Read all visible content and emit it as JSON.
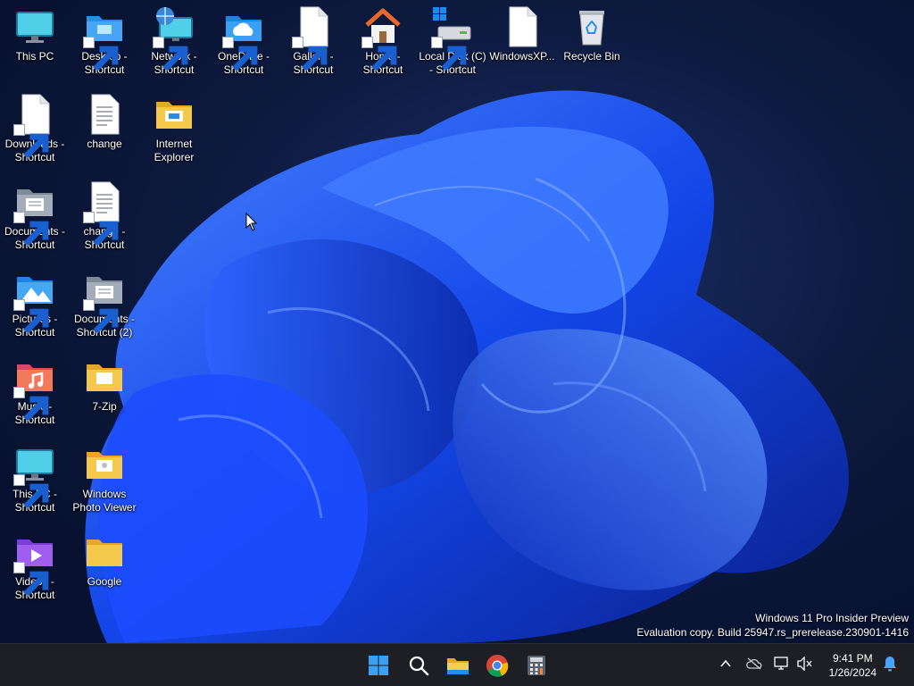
{
  "desktop": {
    "icons": [
      {
        "label": "This PC",
        "icon": "monitor-icon"
      },
      {
        "label": "Desktop -\nShortcut",
        "icon": "folder-desktop-icon"
      },
      {
        "label": "Network -\nShortcut",
        "icon": "network-icon"
      },
      {
        "label": "OneDrive -\nShortcut",
        "icon": "onedrive-folder-icon"
      },
      {
        "label": "Gallery -\nShortcut",
        "icon": "document-icon"
      },
      {
        "label": "Home -\nShortcut",
        "icon": "home-icon"
      },
      {
        "label": "Local Disk (C)\n- Shortcut",
        "icon": "drive-icon"
      },
      {
        "label": "WindowsXP...",
        "icon": "document-icon"
      },
      {
        "label": "Recycle Bin",
        "icon": "recycle-bin-icon"
      },
      {
        "label": "Downloads -\nShortcut",
        "icon": "document-icon"
      },
      {
        "label": "change",
        "icon": "text-file-icon"
      },
      {
        "label": "Internet\nExplorer",
        "icon": "folder-icon"
      },
      {
        "label": "Documents -\nShortcut",
        "icon": "documents-folder-icon"
      },
      {
        "label": "change -\nShortcut",
        "icon": "text-file-icon"
      },
      {
        "label": "Pictures -\nShortcut",
        "icon": "pictures-folder-icon"
      },
      {
        "label": "Documents -\nShortcut (2)",
        "icon": "documents-folder-icon"
      },
      {
        "label": "Music -\nShortcut",
        "icon": "music-folder-icon"
      },
      {
        "label": "7-Zip",
        "icon": "folder-icon"
      },
      {
        "label": "This PC -\nShortcut",
        "icon": "monitor-icon"
      },
      {
        "label": "Windows\nPhoto Viewer",
        "icon": "folder-icon"
      },
      {
        "label": "Videos -\nShortcut",
        "icon": "videos-folder-icon"
      },
      {
        "label": "Google",
        "icon": "folder-icon"
      }
    ]
  },
  "watermark": {
    "line1": "Windows 11 Pro Insider Preview",
    "line2": "Evaluation copy. Build 25947.rs_prerelease.230901-1416"
  },
  "taskbar": {
    "pinned": [
      "start-icon",
      "search-icon",
      "file-explorer-icon",
      "chrome-icon",
      "calculator-icon"
    ],
    "tray": [
      "chevron-up-icon",
      "onedrive-offline-icon",
      "network-icon",
      "volume-muted-icon"
    ],
    "clock": {
      "time": "9:41 PM",
      "date": "1/26/2024"
    },
    "notification_icon": "bell-icon"
  },
  "colors": {
    "taskbar_bg": "#1d1f24",
    "folder_yellow": "#f4c84a",
    "accent_blue": "#1a78f2"
  }
}
